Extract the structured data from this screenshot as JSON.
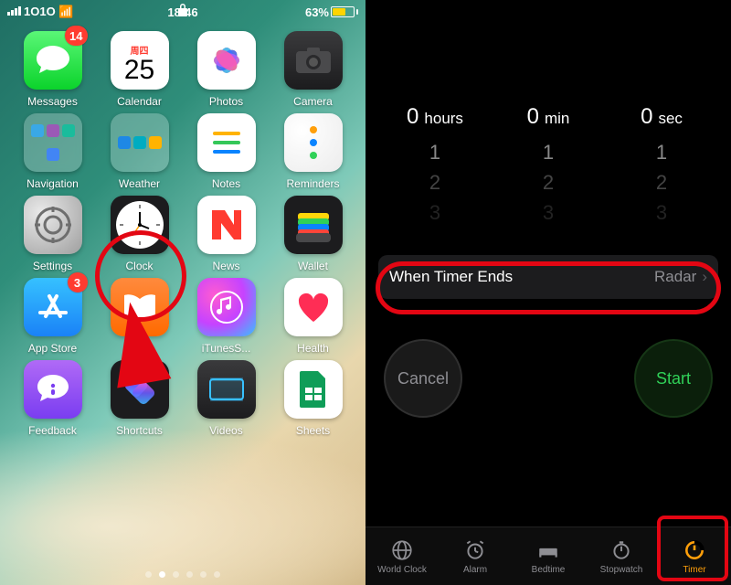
{
  "status": {
    "carrier": "1O1O",
    "time": "18:46",
    "battery_pct": "63%"
  },
  "calendar_icon": {
    "month": "周四",
    "day": "25"
  },
  "badges": {
    "messages": "14",
    "appstore": "3"
  },
  "apps": [
    {
      "label": "Messages"
    },
    {
      "label": "Calendar"
    },
    {
      "label": "Photos"
    },
    {
      "label": "Camera"
    },
    {
      "label": "Navigation"
    },
    {
      "label": "Weather"
    },
    {
      "label": "Notes"
    },
    {
      "label": "Reminders"
    },
    {
      "label": "Settings"
    },
    {
      "label": "Clock"
    },
    {
      "label": "News"
    },
    {
      "label": "Wallet"
    },
    {
      "label": "App Store"
    },
    {
      "label": "Books"
    },
    {
      "label": "iTunesS..."
    },
    {
      "label": "Health"
    },
    {
      "label": "Feedback"
    },
    {
      "label": "Shortcuts"
    },
    {
      "label": "Videos"
    },
    {
      "label": "Sheets"
    }
  ],
  "timer": {
    "picker": {
      "hours": {
        "value": "0",
        "unit": "hours",
        "next": [
          "1",
          "2",
          "3"
        ]
      },
      "minutes": {
        "value": "0",
        "unit": "min",
        "next": [
          "1",
          "2",
          "3"
        ]
      },
      "seconds": {
        "value": "0",
        "unit": "sec",
        "next": [
          "1",
          "2",
          "3"
        ]
      }
    },
    "when_ends_label": "When Timer Ends",
    "when_ends_value": "Radar",
    "cancel": "Cancel",
    "start": "Start",
    "tabs": [
      {
        "label": "World Clock"
      },
      {
        "label": "Alarm"
      },
      {
        "label": "Bedtime"
      },
      {
        "label": "Stopwatch"
      },
      {
        "label": "Timer"
      }
    ]
  }
}
